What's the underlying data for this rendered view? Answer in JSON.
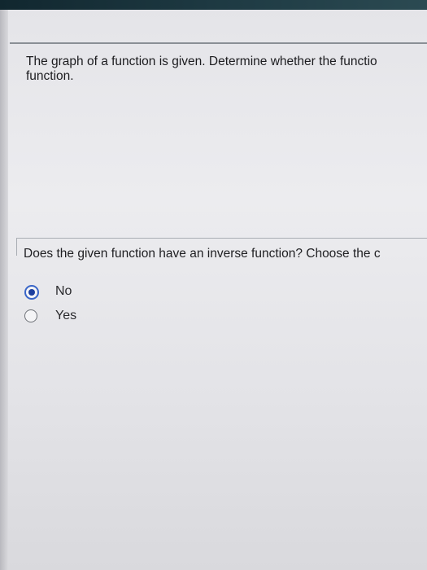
{
  "question": {
    "line1": "The graph of a function is given. Determine whether the functio",
    "line2": "function."
  },
  "sub_question": "Does the given function have an inverse function? Choose the c",
  "options": [
    {
      "label": "No",
      "selected": true
    },
    {
      "label": "Yes",
      "selected": false
    }
  ],
  "colors": {
    "radio_selected": "#1d3f9e",
    "radio_ring": "#3a66c8"
  }
}
